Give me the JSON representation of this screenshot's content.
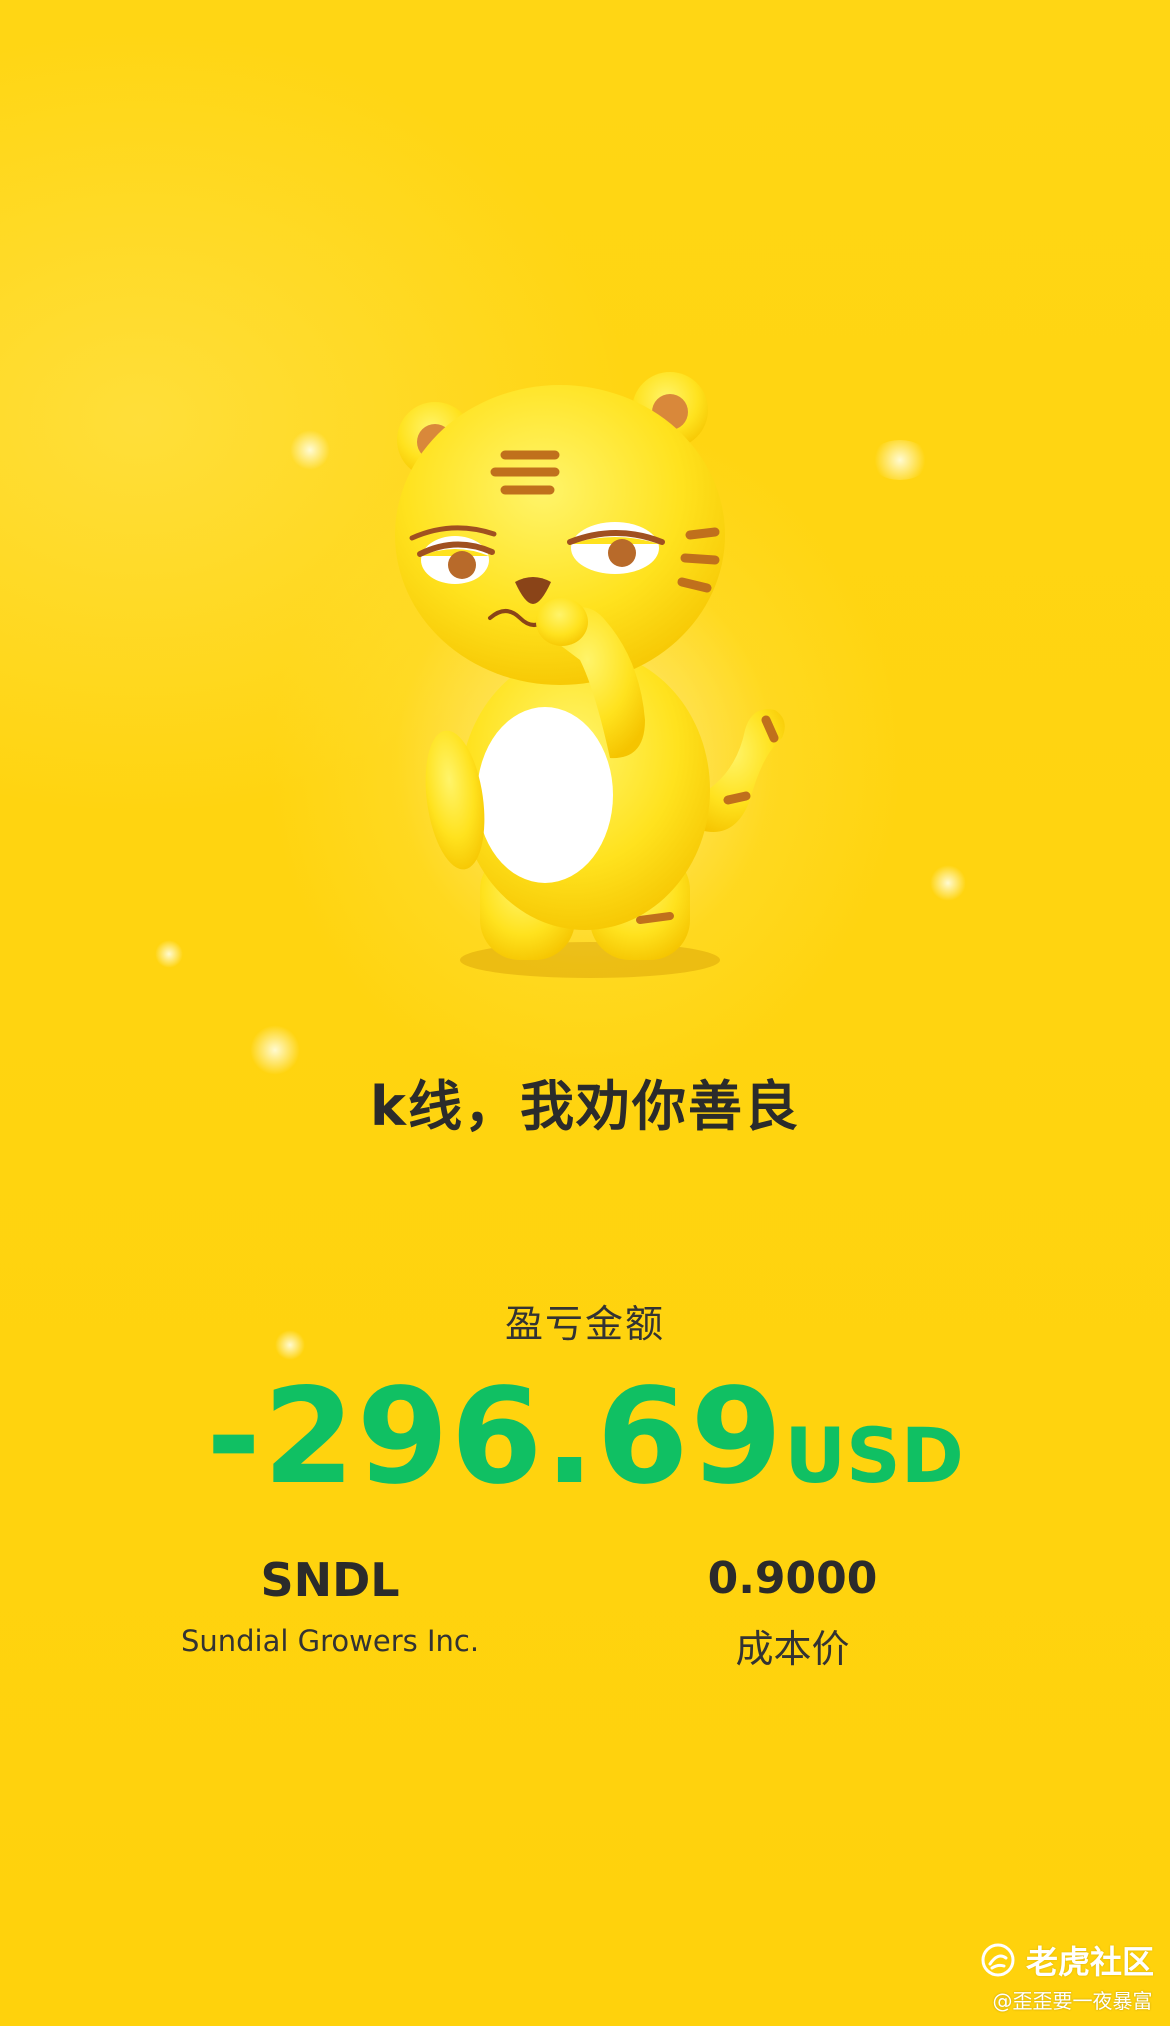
{
  "slogan": "k线，我劝你善良",
  "pnl": {
    "label": "盈亏金额",
    "amount": "-296.69",
    "currency": "USD",
    "color": "#10c063"
  },
  "stock": {
    "ticker": "SNDL",
    "company": "Sundial Growers Inc."
  },
  "cost": {
    "value": "0.9000",
    "label": "成本价"
  },
  "brand": {
    "name": "老虎社区",
    "logo_icon": "tiger-community-logo-icon",
    "watermark": "@歪歪要一夜暴富"
  },
  "mascot_icon": "tiger-mascot-icon",
  "theme": {
    "background": "#ffd20a",
    "text": "#2b2b2b"
  }
}
